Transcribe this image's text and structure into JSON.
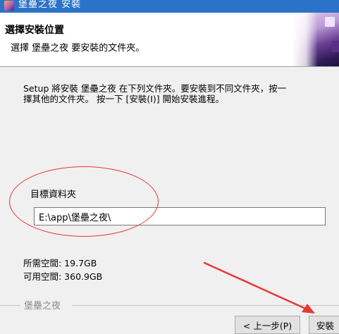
{
  "window": {
    "title": "堡壘之夜 安裝"
  },
  "header": {
    "title": "選擇安裝位置",
    "subtitle": "選擇 堡壘之夜 要安裝的文件夾。"
  },
  "body": {
    "description_line1": "Setup 將安裝 堡壘之夜 在下列文件夾。要安裝到不同文件夾，按一",
    "description_line2": "擇其他的文件夾。 按一下 [安裝(I)] 開始安裝進程。",
    "group_label": "目標資料夾",
    "install_path": "E:\\app\\堡壘之夜\\",
    "space_required": "所需空間: 19.7GB",
    "space_available": "可用空間: 360.9GB"
  },
  "footer": {
    "brand": "堡壘之夜",
    "back_button": "< 上一步(P)",
    "install_button": "安裝"
  },
  "annotations": {
    "accent_color": "#e53935"
  }
}
